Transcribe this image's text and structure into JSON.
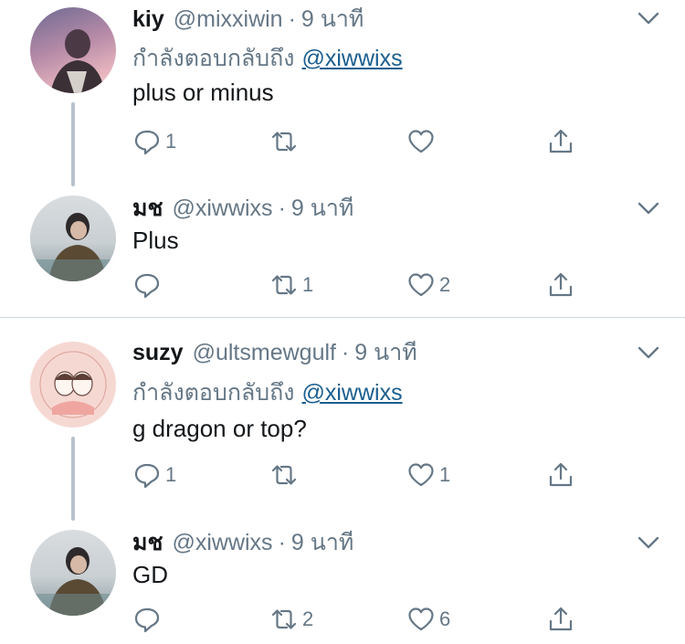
{
  "reply_prefix": "กำลังตอบกลับถึง",
  "tweets": [
    {
      "name": "kiy",
      "handle": "@mixxiwin",
      "sep": "·",
      "time": "9 นาที",
      "reply_to": "@xiwwixs",
      "text": "plus or minus",
      "replies": "1",
      "retweets": "",
      "likes": ""
    },
    {
      "name": "มช",
      "handle": "@xiwwixs",
      "sep": "·",
      "time": "9 นาที",
      "text": "Plus",
      "replies": "",
      "retweets": "1",
      "likes": "2"
    },
    {
      "name": "suzy",
      "handle": "@ultsmewgulf",
      "sep": "·",
      "time": "9 นาที",
      "reply_to": "@xiwwixs",
      "text": "g dragon or top?",
      "replies": "1",
      "retweets": "",
      "likes": "1"
    },
    {
      "name": "มช",
      "handle": "@xiwwixs",
      "sep": "·",
      "time": "9 นาที",
      "text": "GD",
      "replies": "",
      "retweets": "2",
      "likes": "6"
    }
  ],
  "colors": {
    "text": "#14171a",
    "secondary": "#657786",
    "link": "#1b5e8f",
    "thread_line": "#b8c2cc"
  }
}
